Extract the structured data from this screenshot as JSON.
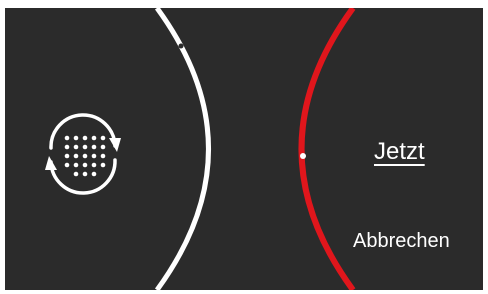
{
  "colors": {
    "background": "#2b2b2b",
    "left_arc": "#ffffff",
    "right_arc": "#e0161c",
    "text": "#ffffff"
  },
  "icon": {
    "name": "sync-matrix-icon"
  },
  "actions": {
    "now_label": "Jetzt",
    "cancel_label": "Abbrechen"
  }
}
